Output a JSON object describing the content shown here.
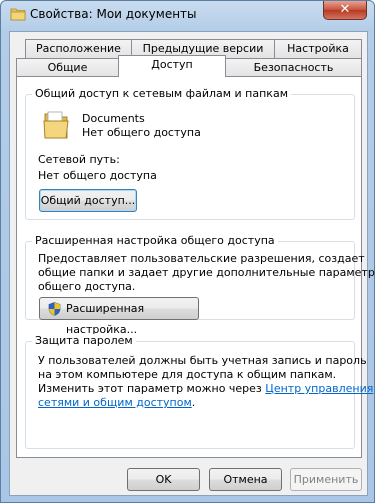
{
  "window": {
    "title": "Свойства: Мои документы",
    "close_label": "✕"
  },
  "tabs": {
    "row_back": [
      "Расположение",
      "Предыдущие версии",
      "Настройка"
    ],
    "row_front": [
      "Общие",
      "Доступ",
      "Безопасность"
    ],
    "active": "Доступ"
  },
  "network_sharing": {
    "title": "Общий доступ к сетевым файлам и папкам",
    "item_name": "Documents",
    "item_status": "Нет общего доступа",
    "network_path_label": "Сетевой путь:",
    "network_path_value": "Нет общего доступа",
    "share_button": "Общий доступ..."
  },
  "advanced_sharing": {
    "title": "Расширенная настройка общего доступа",
    "description_lines": [
      "Предоставляет пользовательские разрешения, создает",
      "общие папки и задает другие дополнительные параметры",
      "общего доступа."
    ],
    "button": "Расширенная настройка..."
  },
  "password": {
    "title": "Защита паролем",
    "description_lines": [
      "У пользователей должны быть учетная запись и пароль",
      "на этом компьютере для доступа к общим папкам."
    ],
    "change_prefix": "Изменить этот параметр можно через",
    "link_part1": "Центр управления",
    "link_part2": "сетями и общим доступом",
    "link_suffix": "."
  },
  "buttons": {
    "ok": "OK",
    "cancel": "Отмена",
    "apply": "Применить"
  }
}
